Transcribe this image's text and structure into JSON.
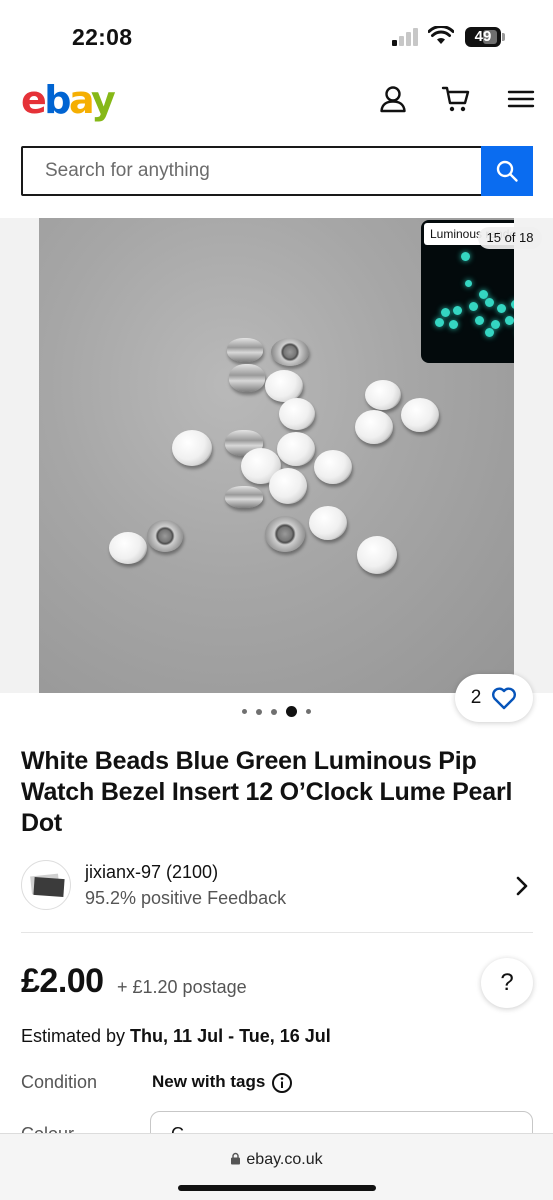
{
  "status": {
    "time": "22:08",
    "battery": "49"
  },
  "header": {
    "logo": {
      "e": "e",
      "b": "b",
      "a": "a",
      "y": "y"
    }
  },
  "search": {
    "placeholder": "Search for anything"
  },
  "gallery": {
    "thumb_label": "Luminous rendering",
    "counter": "15 of 18",
    "likes": "2",
    "dot_count": 5,
    "active_dot_index": 3
  },
  "listing": {
    "title": "White Beads Blue Green Luminous Pip Watch Bezel Insert 12 O’Clock Lume Pearl Dot",
    "seller": {
      "name": "jixianx-97 (2100)",
      "feedback": "95.2% positive Feedback"
    },
    "price": "£2.00",
    "postage": "+ £1.20 postage",
    "estimated_label": "Estimated by ",
    "estimated_dates": "Thu, 11 Jul - Tue, 16 Jul",
    "condition_label": "Condition",
    "condition_value": "New with tags",
    "colour_label": "Colour",
    "colour_value": "C",
    "help": "?"
  },
  "browser": {
    "url": "ebay.co.uk"
  },
  "colors": {
    "accent": "#0a6cf0",
    "like": "#0654ba"
  }
}
